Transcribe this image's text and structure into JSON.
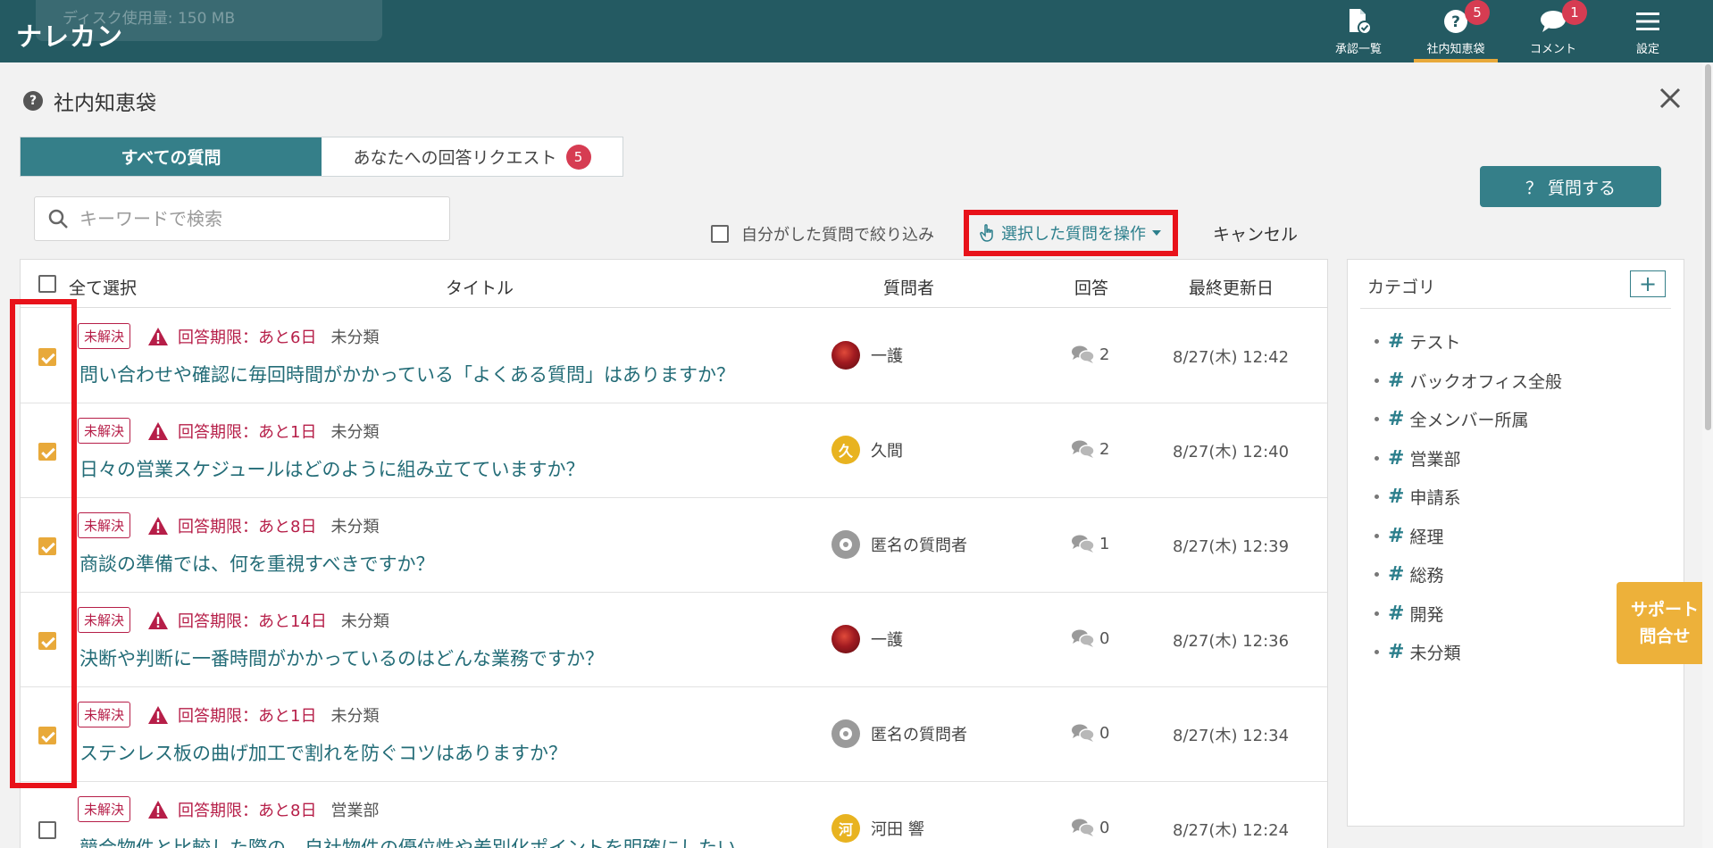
{
  "header": {
    "ghost_toast": "ディスク使用量: 150 MB",
    "logo": "ナレカン",
    "nav": [
      {
        "label": "承認一覧",
        "icon": "document-check-icon",
        "badge": ""
      },
      {
        "label": "社内知恵袋",
        "icon": "question-circle-icon",
        "badge": "5"
      },
      {
        "label": "コメント",
        "icon": "speech-bubble-icon",
        "badge": "1"
      },
      {
        "label": "設定",
        "icon": "hamburger-menu-icon",
        "badge": ""
      }
    ]
  },
  "page": {
    "title": "社内知恵袋",
    "close_icon": "close-icon"
  },
  "tabs": {
    "all": "すべての質問",
    "requests": "あなたへの回答リクエスト",
    "requests_badge": "5"
  },
  "ask_button": "？ 質問する",
  "search": {
    "placeholder": "キーワードで検索"
  },
  "toolbar": {
    "filter_label": "自分がした質問で絞り込み",
    "operate_label": "選択した質問を操作",
    "cancel_label": "キャンセル"
  },
  "table": {
    "headers": {
      "select_all": "全て選択",
      "title": "タイトル",
      "asker": "質問者",
      "answers": "回答",
      "updated": "最終更新日"
    },
    "rows": [
      {
        "checked": true,
        "status": "未解決",
        "deadline": "回答期限：あと6日",
        "category": "未分類",
        "title": "問い合わせや確認に毎回時間がかかっている「よくある質問」はありますか？",
        "asker": "一護",
        "avatar": "photo",
        "avatar_char": "",
        "answers": "2",
        "updated": "8/27(木) 12:42"
      },
      {
        "checked": true,
        "status": "未解決",
        "deadline": "回答期限：あと1日",
        "category": "未分類",
        "title": "日々の営業スケジュールはどのように組み立てていますか？",
        "asker": "久間",
        "avatar": "yellow",
        "avatar_char": "久",
        "answers": "2",
        "updated": "8/27(木) 12:40"
      },
      {
        "checked": true,
        "status": "未解決",
        "deadline": "回答期限：あと8日",
        "category": "未分類",
        "title": "商談の準備では、何を重視すべきですか？",
        "asker": "匿名の質問者",
        "avatar": "anon",
        "avatar_char": "",
        "answers": "1",
        "updated": "8/27(木) 12:39"
      },
      {
        "checked": true,
        "status": "未解決",
        "deadline": "回答期限：あと14日",
        "category": "未分類",
        "title": "決断や判断に一番時間がかかっているのはどんな業務ですか？",
        "asker": "一護",
        "avatar": "photo",
        "avatar_char": "",
        "answers": "0",
        "updated": "8/27(木) 12:36"
      },
      {
        "checked": true,
        "status": "未解決",
        "deadline": "回答期限：あと1日",
        "category": "未分類",
        "title": "ステンレス板の曲げ加工で割れを防ぐコツはありますか？",
        "asker": "匿名の質問者",
        "avatar": "anon",
        "avatar_char": "",
        "answers": "0",
        "updated": "8/27(木) 12:34"
      },
      {
        "checked": false,
        "status": "未解決",
        "deadline": "回答期限：あと8日",
        "category": "営業部",
        "title": "競合物件と比較した際の、自社物件の優位性や差別化ポイントを明確にしたい",
        "asker": "河田 響",
        "avatar": "yellow",
        "avatar_char": "河",
        "answers": "0",
        "updated": "8/27(木) 12:24"
      }
    ]
  },
  "categories": {
    "heading": "カテゴリ",
    "add_label": "+",
    "items": [
      "テスト",
      "バックオフィス全般",
      "全メンバー所属",
      "営業部",
      "申請系",
      "経理",
      "総務",
      "開発",
      "未分類"
    ]
  },
  "support": {
    "line1": "サポート",
    "line2": "問合せ"
  },
  "colors": {
    "header": "#245a62",
    "accent": "#357f89",
    "alert": "#b61e48",
    "highlight": "#e8121a",
    "checkbox": "#e8a93a"
  }
}
